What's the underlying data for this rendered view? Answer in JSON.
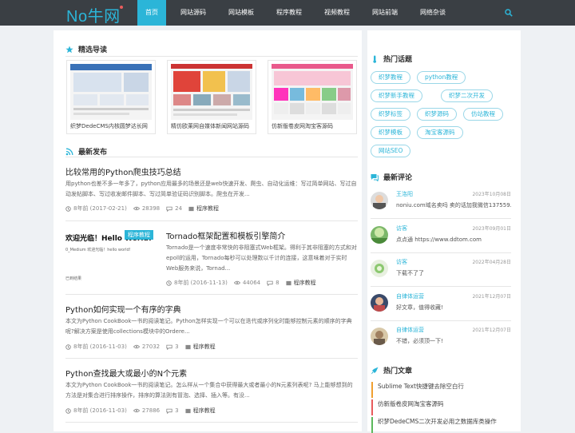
{
  "brand": {
    "logo": "No牛网",
    "accent": "#2bb5d8",
    "dark": "#3a3f44"
  },
  "nav": {
    "items": [
      "首页",
      "网站源码",
      "网站模板",
      "程序教程",
      "视频教程",
      "网站前端",
      "网络杂谈"
    ],
    "active": 0
  },
  "featured": {
    "title": "精选导读",
    "items": [
      {
        "caption": "织梦DedeCMS内核圆梦达长网"
      },
      {
        "caption": "精仿欧莱网自媒体新闻网站源码"
      },
      {
        "caption": "仿新版卷皮网淘宝客源码"
      }
    ]
  },
  "latest": {
    "title": "最新发布",
    "posts": [
      {
        "title": "比较常用的Python爬虫技巧总结",
        "desc": "用python也差不多一年多了，python应用最多的场景还是web快速开发、爬虫、自动化运维：写过简单网站、写过自动发帖脚本、写过收发邮件脚本、写过简单验证码识别脚本。爬虫在开发...",
        "time": "8年前 (2017-02-21)",
        "views": "28398",
        "comments": "24",
        "cat": "程序教程"
      },
      {
        "title": "Tornado框架配置和模板引擎简介",
        "desc": "Tornado是一个速度非常快的非阻塞式Web框架。得利于其非阻塞的方式和对epoll的运用，Tornado每秒可以处理数以千计的连接，这意味着对于实时Web服务来说，Tornad...",
        "time": "8年前 (2016-11-13)",
        "views": "44064",
        "comments": "8",
        "cat": "程序教程",
        "badge": "程序教程",
        "thumb_text": "欢迎光临！Hello World!",
        "thumb_sub": "0_Medium 欢迎光临！hello world!",
        "thumb_sub2": "已到结果"
      },
      {
        "title": "Python如何实现一个有序的字典",
        "desc": "本文为Python CookBook一书的阅读笔记。Python怎样实现一个可以在迭代或序列化时能够控制元素的顺序的字典呢?解决方案是使用collections模块中的Ordere...",
        "time": "8年前 (2016-11-03)",
        "views": "27032",
        "comments": "3",
        "cat": "程序教程"
      },
      {
        "title": "Python查找最大或最小的N个元素",
        "desc": "本文为Python CookBook一书的阅读笔记。怎么样从一个集合中获得最大或者最小的N元素列表呢? 马上能够想到的方法是对集合进行排序操作，排序的算法则有冒泡、选择、插入等。有没...",
        "time": "8年前 (2016-11-03)",
        "views": "27886",
        "comments": "3",
        "cat": "程序教程"
      }
    ]
  },
  "hot_tags": {
    "title": "热门话题",
    "tags": [
      "织梦教程",
      "python教程",
      "织梦新手教程",
      "织梦二次开发",
      "织梦标签",
      "织梦源码",
      "仿站教程",
      "织梦模板",
      "淘宝客源码",
      "网站SEO"
    ]
  },
  "comments": {
    "title": "最新评论",
    "items": [
      {
        "name": "王洛阳",
        "date": "2023年10月08日",
        "text": "noniu.com域名卖吗 卖的话加我微信137559..."
      },
      {
        "name": "访客",
        "date": "2023年09月01日",
        "text": "点点通 https://www.ddtom.com"
      },
      {
        "name": "访客",
        "date": "2022年04月28日",
        "text": "下载不了了"
      },
      {
        "name": "自律体运营",
        "date": "2021年12月07日",
        "text": "好文章，值得收藏!"
      },
      {
        "name": "自律体运营",
        "date": "2021年12月07日",
        "text": "不错，必须顶一下!"
      }
    ]
  },
  "hot_articles": {
    "title": "热门文章",
    "items": [
      "Sublime Text快捷键去除空白行",
      "仿新版卷皮网淘宝客源码",
      "织梦DedeCMS二次开发必用之数据库类操作"
    ]
  }
}
